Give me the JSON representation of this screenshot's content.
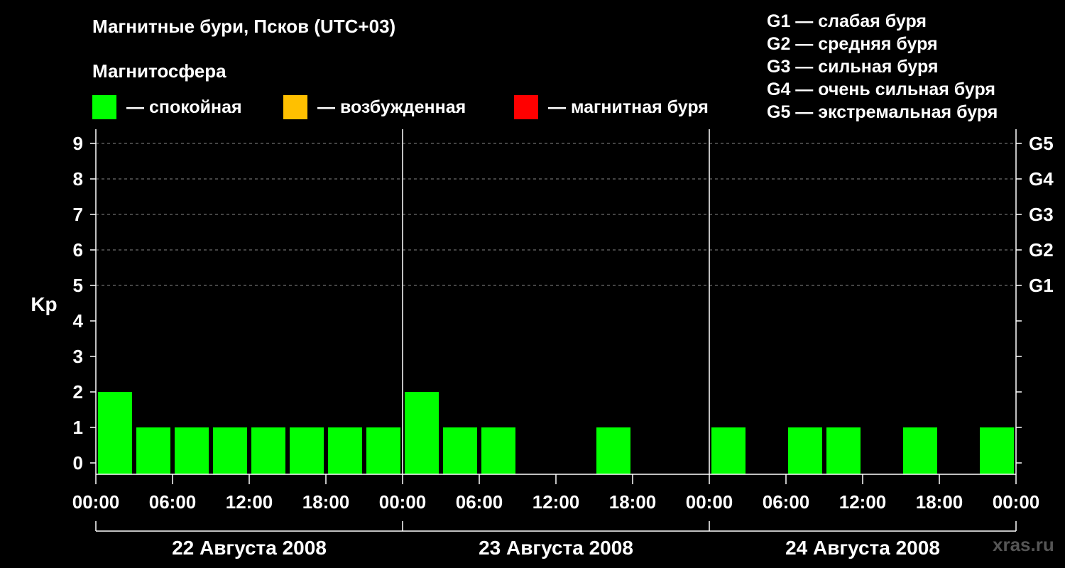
{
  "chart_data": {
    "type": "bar",
    "title": "Магнитные бури, Псков (UTC+03)",
    "subtitle": "Магнитосфера",
    "ylabel": "Kp",
    "ylim": [
      0,
      9
    ],
    "yticks": [
      "0",
      "1",
      "2",
      "3",
      "4",
      "5",
      "6",
      "7",
      "8",
      "9"
    ],
    "right_ticks": [
      {
        "value": 5,
        "label": "G1"
      },
      {
        "value": 6,
        "label": "G2"
      },
      {
        "value": 7,
        "label": "G3"
      },
      {
        "value": 8,
        "label": "G4"
      },
      {
        "value": 9,
        "label": "G5"
      }
    ],
    "xtick_labels": [
      "00:00",
      "06:00",
      "12:00",
      "18:00",
      "00:00",
      "06:00",
      "12:00",
      "18:00",
      "00:00",
      "06:00",
      "12:00",
      "18:00",
      "00:00"
    ],
    "days": [
      "22 Августа 2008",
      "23 Августа 2008",
      "24 Августа 2008"
    ],
    "bar_interval_hours": 3,
    "values": [
      2,
      1,
      1,
      1,
      1,
      1,
      1,
      1,
      2,
      1,
      1,
      0,
      0,
      1,
      0,
      0,
      1,
      0,
      1,
      1,
      0,
      1,
      0,
      1
    ],
    "grid": "dashed at 5–9",
    "colors": {
      "calm": "#00ff00",
      "excited": "#ffc000",
      "storm": "#ff0000",
      "axis": "#ffffff",
      "grid": "#888888"
    }
  },
  "legend": {
    "calm": {
      "color": "#00ff00",
      "label": "— спокойная"
    },
    "excited": {
      "color": "#ffc000",
      "label": "— возбужденная"
    },
    "storm": {
      "color": "#ff0000",
      "label": "— магнитная буря"
    }
  },
  "g_scale": [
    "G1 — слабая буря",
    "G2 — средняя буря",
    "G3 — сильная буря",
    "G4 — очень сильная буря",
    "G5 — экстремальная буря"
  ],
  "watermark": "xras.ru"
}
